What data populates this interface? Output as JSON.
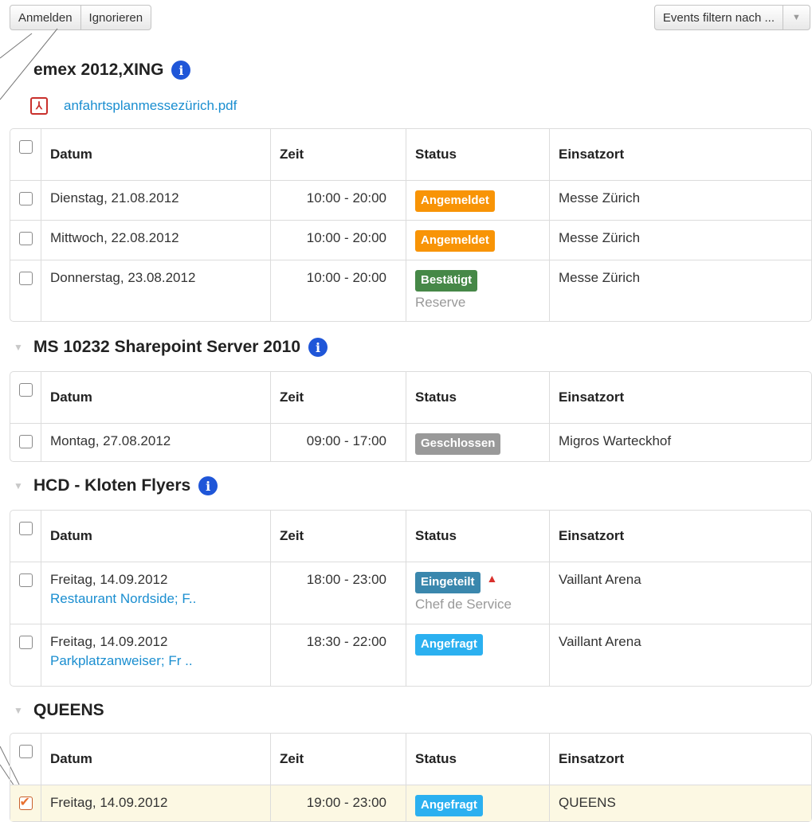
{
  "toolbar": {
    "register_label": "Anmelden",
    "ignore_label": "Ignorieren",
    "filter_label": "Events filtern nach ..."
  },
  "columns": {
    "date": "Datum",
    "time": "Zeit",
    "status": "Status",
    "location": "Einsatzort"
  },
  "colors": {
    "angemeldet": "#f89406",
    "bestaetigt": "#468847",
    "geschlossen": "#999999",
    "eingeteilt": "#3a87ad",
    "angefragt": "#2bb0f0",
    "info": "#1f56d8"
  },
  "events": [
    {
      "title": "emex 2012,XING",
      "attachment": "anfahrtsplanmessezürich.pdf",
      "rows": [
        {
          "date": "Dienstag, 21.08.2012",
          "time": "10:00 - 20:00",
          "status": "Angemeldet",
          "location": "Messe Zürich"
        },
        {
          "date": "Mittwoch, 22.08.2012",
          "time": "10:00 - 20:00",
          "status": "Angemeldet",
          "location": "Messe Zürich"
        },
        {
          "date": "Donnerstag, 23.08.2012",
          "time": "10:00 - 20:00",
          "status": "Bestätigt",
          "status_note": "Reserve",
          "location": "Messe Zürich"
        }
      ]
    },
    {
      "title": "MS 10232 Sharepoint Server 2010",
      "rows": [
        {
          "date": "Montag, 27.08.2012",
          "time": "09:00 - 17:00",
          "status": "Geschlossen",
          "location": "Migros Warteckhof"
        }
      ]
    },
    {
      "title": "HCD - Kloten Flyers",
      "rows": [
        {
          "date": "Freitag, 14.09.2012",
          "date_link": "Restaurant Nordside; F..",
          "time": "18:00 - 23:00",
          "status": "Eingeteilt",
          "status_note": "Chef de Service",
          "location": "Vaillant Arena"
        },
        {
          "date": "Freitag, 14.09.2012",
          "date_link": "Parkplatzanweiser; Fr ..",
          "time": "18:30 - 22:00",
          "status": "Angefragt",
          "location": "Vaillant Arena"
        }
      ]
    },
    {
      "title": "QUEENS",
      "rows": [
        {
          "date": "Freitag, 14.09.2012",
          "time": "19:00 - 23:00",
          "status": "Angefragt",
          "location": "QUEENS"
        }
      ]
    }
  ]
}
